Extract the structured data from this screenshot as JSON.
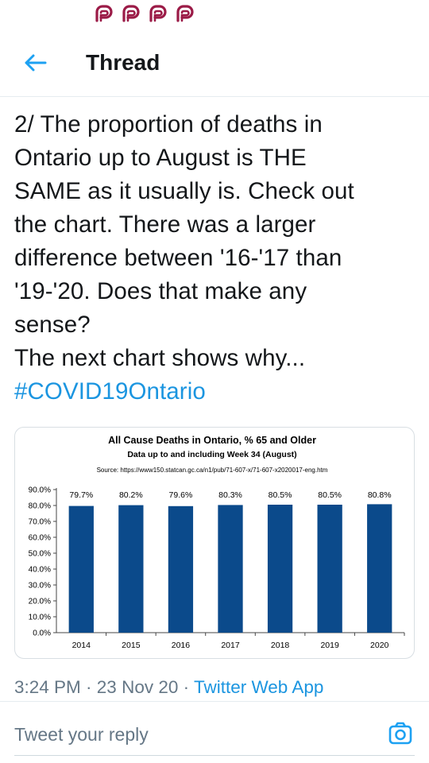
{
  "status_bar": {
    "icons": [
      "parler-icon",
      "parler-icon",
      "parler-icon",
      "parler-icon"
    ],
    "icon_color": "#9b1b47"
  },
  "header": {
    "title": "Thread",
    "accent": "#1da1f2"
  },
  "tweet": {
    "text": "2/ The proportion of deaths in\nOntario up to August is THE\nSAME as it usually is. Check out\nthe chart. There was a larger\ndifference between '16-'17 than\n'19-'20. Does that make any\nsense?\nThe next chart shows why...",
    "hashtag": "#COVID19Ontario",
    "timestamp": "3:24 PM · 23 Nov 20 · ",
    "source": "Twitter Web App"
  },
  "chart_data": {
    "type": "bar",
    "title": "All Cause Deaths in Ontario, % 65 and Older",
    "subtitle": "Data up to and including Week 34 (August)",
    "source_note": "Source: https://www150.statcan.gc.ca/n1/pub/71-607-x/71-607-x2020017-eng.htm",
    "categories": [
      "2014",
      "2015",
      "2016",
      "2017",
      "2018",
      "2019",
      "2020"
    ],
    "values": [
      79.7,
      80.2,
      79.6,
      80.3,
      80.5,
      80.5,
      80.8
    ],
    "data_labels": [
      "79.7%",
      "80.2%",
      "79.6%",
      "80.3%",
      "80.5%",
      "80.5%",
      "80.8%"
    ],
    "y_ticks": [
      "90.0%",
      "80.0%",
      "70.0%",
      "60.0%",
      "50.0%",
      "40.0%",
      "30.0%",
      "20.0%",
      "10.0%",
      "0.0%"
    ],
    "ylim": [
      0,
      90
    ],
    "bar_color": "#0b4a8b",
    "grid": false
  },
  "reply": {
    "placeholder": "Tweet your reply"
  }
}
